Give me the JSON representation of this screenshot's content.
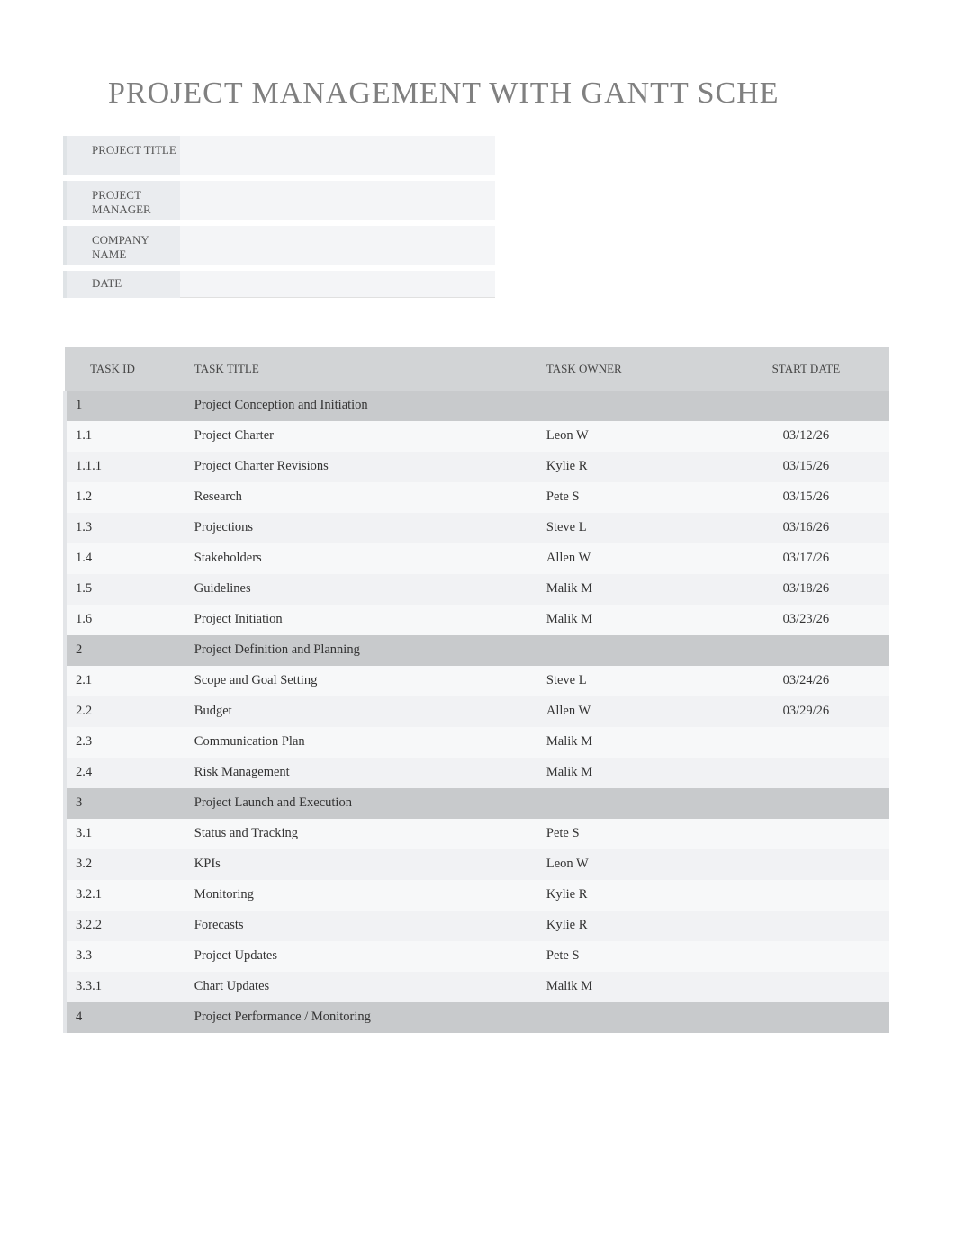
{
  "page_title": "PROJECT MANAGEMENT WITH GANTT SCHE",
  "info": {
    "project_title_label": "PROJECT TITLE",
    "project_title_value": "",
    "project_manager_label": "PROJECT MANAGER",
    "project_manager_value": "",
    "company_name_label": "COMPANY NAME",
    "company_name_value": "",
    "date_label": "DATE",
    "date_value": ""
  },
  "table": {
    "headers": {
      "id": "TASK ID",
      "title": "TASK TITLE",
      "owner": "TASK OWNER",
      "start": "START DATE"
    },
    "rows": [
      {
        "id": "1",
        "title": "Project Conception and Initiation",
        "owner": "",
        "start": "",
        "group": true,
        "indent": 0,
        "owner_indent": 0
      },
      {
        "id": "1.1",
        "title": "Project Charter",
        "owner": "Leon W",
        "start": "03/12/26",
        "group": false,
        "indent": 1,
        "owner_indent": 0
      },
      {
        "id": "1.1.1",
        "title": "Project Charter Revisions",
        "owner": "Kylie R",
        "start": "03/15/26",
        "group": false,
        "indent": 2,
        "owner_indent": 1
      },
      {
        "id": "1.2",
        "title": "Research",
        "owner": "Pete S",
        "start": "03/15/26",
        "group": false,
        "indent": 1,
        "owner_indent": 0
      },
      {
        "id": "1.3",
        "title": "Projections",
        "owner": "Steve L",
        "start": "03/16/26",
        "group": false,
        "indent": 1,
        "owner_indent": 0
      },
      {
        "id": "1.4",
        "title": "Stakeholders",
        "owner": "Allen W",
        "start": "03/17/26",
        "group": false,
        "indent": 1,
        "owner_indent": 0
      },
      {
        "id": "1.5",
        "title": "Guidelines",
        "owner": "Malik M",
        "start": "03/18/26",
        "group": false,
        "indent": 1,
        "owner_indent": 0
      },
      {
        "id": "1.6",
        "title": "Project Initiation",
        "owner": "Malik M",
        "start": "03/23/26",
        "group": false,
        "indent": 1,
        "owner_indent": 0
      },
      {
        "id": "2",
        "title": "Project Definition and Planning",
        "owner": "",
        "start": "",
        "group": true,
        "indent": 0,
        "owner_indent": 0
      },
      {
        "id": "2.1",
        "title": "Scope and Goal Setting",
        "owner": "Steve L",
        "start": "03/24/26",
        "group": false,
        "indent": 1,
        "owner_indent": 0
      },
      {
        "id": "2.2",
        "title": "Budget",
        "owner": "Allen W",
        "start": "03/29/26",
        "group": false,
        "indent": 1,
        "owner_indent": 0
      },
      {
        "id": "2.3",
        "title": "Communication Plan",
        "owner": "Malik M",
        "start": "",
        "group": false,
        "indent": 1,
        "owner_indent": 0
      },
      {
        "id": "2.4",
        "title": "Risk Management",
        "owner": "Malik M",
        "start": "",
        "group": false,
        "indent": 1,
        "owner_indent": 0
      },
      {
        "id": "3",
        "title": "Project Launch and Execution",
        "owner": "",
        "start": "",
        "group": true,
        "indent": 0,
        "owner_indent": 0
      },
      {
        "id": "3.1",
        "title": "Status and Tracking",
        "owner": "Pete S",
        "start": "",
        "group": false,
        "indent": 1,
        "owner_indent": 0
      },
      {
        "id": "3.2",
        "title": "KPIs",
        "owner": "Leon W",
        "start": "",
        "group": false,
        "indent": 1,
        "owner_indent": 0
      },
      {
        "id": "3.2.1",
        "title": "Monitoring",
        "owner": "Kylie R",
        "start": "",
        "group": false,
        "indent": 2,
        "owner_indent": 1
      },
      {
        "id": "3.2.2",
        "title": "Forecasts",
        "owner": "Kylie R",
        "start": "",
        "group": false,
        "indent": 2,
        "owner_indent": 1
      },
      {
        "id": "3.3",
        "title": "Project Updates",
        "owner": "Pete S",
        "start": "",
        "group": false,
        "indent": 1,
        "owner_indent": 0
      },
      {
        "id": "3.3.1",
        "title": "Chart Updates",
        "owner": "Malik M",
        "start": "",
        "group": false,
        "indent": 2,
        "owner_indent": 1
      },
      {
        "id": "4",
        "title": "Project Performance / Monitoring",
        "owner": "",
        "start": "",
        "group": true,
        "indent": 0,
        "owner_indent": 0
      }
    ]
  }
}
